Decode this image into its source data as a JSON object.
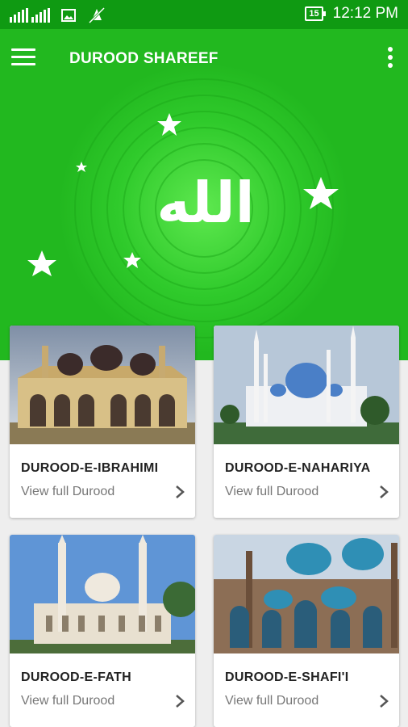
{
  "status_bar": {
    "time": "12:12 PM",
    "battery": "15",
    "icons": [
      "signal-icon",
      "image-icon",
      "no-sync-icon"
    ]
  },
  "app_bar": {
    "title": "DUROOD SHAREEF",
    "menu_icon": "hamburger-menu-icon",
    "overflow_icon": "more-vert-icon"
  },
  "hero": {
    "background_color": "#22b81f",
    "calligraphy": "الله"
  },
  "cards": [
    {
      "title": "DUROOD-E-IBRAHIMI",
      "subtitle": "View full Durood"
    },
    {
      "title": "DUROOD-E-NAHARIYA",
      "subtitle": "View full Durood"
    },
    {
      "title": "DUROOD-E-FATH",
      "subtitle": "View full Durood"
    },
    {
      "title": "DUROOD-E-SHAFI'I",
      "subtitle": "View full Durood"
    }
  ],
  "colors": {
    "status_bar": "#0f9a12",
    "accent_green": "#22b81f",
    "card_title": "#222222",
    "card_subtitle": "#777777"
  }
}
